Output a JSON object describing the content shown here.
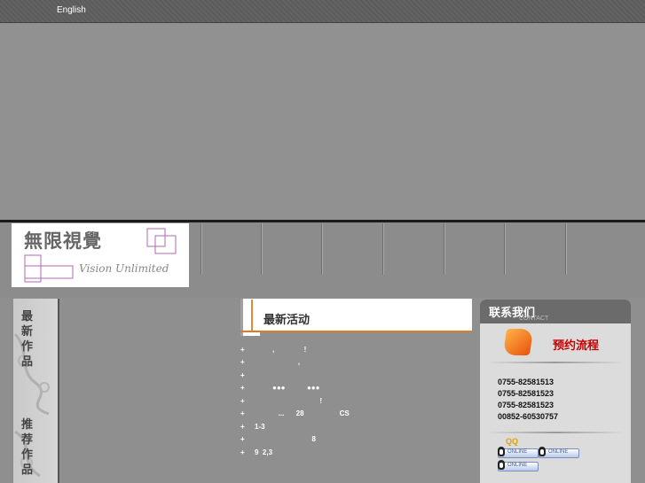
{
  "header": {
    "language_link": "English"
  },
  "logo": {
    "chinese": "無限視覺",
    "english": "Vision Unlimited"
  },
  "nav": {
    "items": [
      "",
      "",
      "",
      "",
      "",
      "",
      ""
    ]
  },
  "sidebar": {
    "latest_works": "最新作品",
    "recommended_works": "推荐作品"
  },
  "news": {
    "title": "最新活动",
    "accent_color": "#e07b2a",
    "bullet": "+",
    "items": [
      "         ,               !",
      "                      ,",
      "",
      "         ●●●           ●●●",
      "                                 !",
      "            ...      28                  CS",
      "1-3",
      "                             8",
      "9  2,3"
    ]
  },
  "contact": {
    "title": "联系我们",
    "subtitle": "CONTACT",
    "booking_label": "预约流程",
    "phones": [
      "0755-82581513",
      "0755-82581523",
      "0755-82581523",
      "00852-60530757"
    ],
    "qq_label": "QQ",
    "qq_buttons": [
      "ONLINE",
      "ONLINE",
      "ONLINE"
    ]
  }
}
